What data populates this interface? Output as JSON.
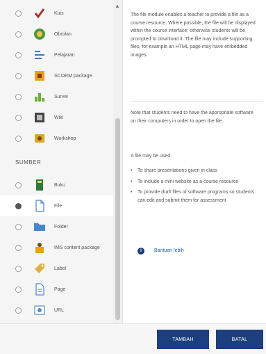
{
  "activities": [
    {
      "label": "Kuis",
      "icon": "quiz-icon",
      "color": "#b0322a",
      "selected": false
    },
    {
      "label": "Obrolan",
      "icon": "chat-icon",
      "color": "#4a9a3c",
      "selected": false
    },
    {
      "label": "Pelajaran",
      "icon": "lesson-icon",
      "color": "#3a7cc4",
      "selected": false
    },
    {
      "label": "SCORM package",
      "icon": "scorm-icon",
      "color": "#e8a020",
      "selected": false
    },
    {
      "label": "Survei",
      "icon": "survey-icon",
      "color": "#6fae3a",
      "selected": false
    },
    {
      "label": "Wiki",
      "icon": "wiki-icon",
      "color": "#444444",
      "selected": false
    },
    {
      "label": "Workshop",
      "icon": "workshop-icon",
      "color": "#d6a82c",
      "selected": false
    }
  ],
  "section_title": "SUMBER",
  "resources": [
    {
      "label": "Buku",
      "icon": "book-icon",
      "color": "#2f7a3a",
      "selected": false
    },
    {
      "label": "File",
      "icon": "file-icon",
      "color": "#4a86c8",
      "selected": true
    },
    {
      "label": "Folder",
      "icon": "folder-icon",
      "color": "#4a86c8",
      "selected": false
    },
    {
      "label": "IMS content package",
      "icon": "ims-package-icon",
      "color": "#e8a020",
      "selected": false
    },
    {
      "label": "Label",
      "icon": "label-icon",
      "color": "#e0b040",
      "selected": false
    },
    {
      "label": "Page",
      "icon": "page-icon",
      "color": "#4a86c8",
      "selected": false
    },
    {
      "label": "URL",
      "icon": "url-icon",
      "color": "#5a8fbf",
      "selected": false
    }
  ],
  "description": {
    "para1": "The file module enables a teacher to provide a file as a course resource. Where possible, the file will be displayed within the course interface; otherwise students will be prompted to download it. The file may include supporting files, for example an HTML page may have embedded images.",
    "para2": "Note that students need to have the appropriate software on their computers in order to open the file.",
    "para3": "A file may be used",
    "bullets": [
      "To share presentations given in class",
      "To include a mini website as a course resource",
      "To provide draft files of software programs so students can edit and submit them for assessment"
    ],
    "more_help": "Bantuan lebih"
  },
  "buttons": {
    "add": "TAMBAH",
    "cancel": "BATAL"
  }
}
